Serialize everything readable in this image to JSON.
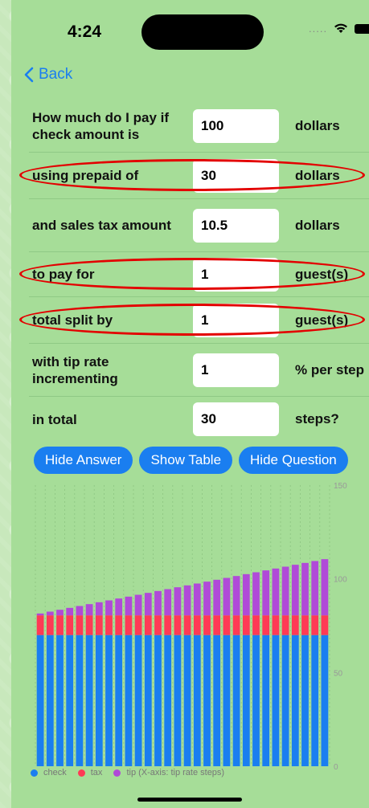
{
  "status": {
    "time": "4:24",
    "dots": "....."
  },
  "nav": {
    "back_label": "Back"
  },
  "form": {
    "rows": [
      {
        "label": "How much do I pay if check amount is",
        "value": "100",
        "unit": "dollars"
      },
      {
        "label": "using prepaid of",
        "value": "30",
        "unit": "dollars"
      },
      {
        "label": "and sales tax amount",
        "value": "10.5",
        "unit": "dollars"
      },
      {
        "label": "to pay for",
        "value": "1",
        "unit": "guest(s)"
      },
      {
        "label": "total split by",
        "value": "1",
        "unit": "guest(s)"
      },
      {
        "label": "with tip rate incrementing",
        "value": "1",
        "unit": "% per step"
      },
      {
        "label": "in total",
        "value": "30",
        "unit": "steps?"
      }
    ]
  },
  "buttons": {
    "hide_answer": "Hide Answer",
    "show_table": "Show Table",
    "hide_question": "Hide Question"
  },
  "colors": {
    "check": "#1a7ef0",
    "tax": "#ff3a55",
    "tip": "#b04ad8",
    "accent": "#1a7ef0",
    "highlight": "#e30000"
  },
  "chart_data": {
    "type": "bar",
    "stacked": true,
    "ylim": [
      0,
      150
    ],
    "yticks": [
      "0",
      "50",
      "100",
      "150"
    ],
    "x": [
      1,
      2,
      3,
      4,
      5,
      6,
      7,
      8,
      9,
      10,
      11,
      12,
      13,
      14,
      15,
      16,
      17,
      18,
      19,
      20,
      21,
      22,
      23,
      24,
      25,
      26,
      27,
      28,
      29,
      30
    ],
    "series": [
      {
        "name": "check",
        "values": [
          70,
          70,
          70,
          70,
          70,
          70,
          70,
          70,
          70,
          70,
          70,
          70,
          70,
          70,
          70,
          70,
          70,
          70,
          70,
          70,
          70,
          70,
          70,
          70,
          70,
          70,
          70,
          70,
          70,
          70
        ]
      },
      {
        "name": "tax",
        "values": [
          10.5,
          10.5,
          10.5,
          10.5,
          10.5,
          10.5,
          10.5,
          10.5,
          10.5,
          10.5,
          10.5,
          10.5,
          10.5,
          10.5,
          10.5,
          10.5,
          10.5,
          10.5,
          10.5,
          10.5,
          10.5,
          10.5,
          10.5,
          10.5,
          10.5,
          10.5,
          10.5,
          10.5,
          10.5,
          10.5
        ]
      },
      {
        "name": "tip",
        "values": [
          1,
          2,
          3,
          4,
          5,
          6,
          7,
          8,
          9,
          10,
          11,
          12,
          13,
          14,
          15,
          16,
          17,
          18,
          19,
          20,
          21,
          22,
          23,
          24,
          25,
          26,
          27,
          28,
          29,
          30
        ]
      }
    ],
    "legend": [
      "check",
      "tax",
      "tip (X-axis: tip rate steps)"
    ],
    "legend_position": "bottom-left",
    "grid": true
  }
}
